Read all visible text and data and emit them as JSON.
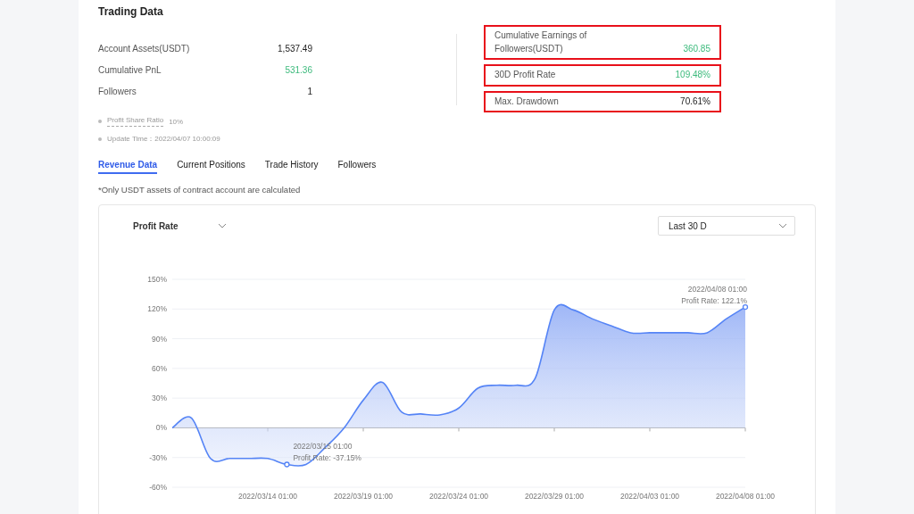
{
  "section_title": "Trading Data",
  "stats": [
    {
      "label": "Account Assets(USDT)",
      "value": "1,537.49",
      "positive": false
    },
    {
      "label": "Cumulative PnL",
      "value": "531.36",
      "positive": true
    },
    {
      "label": "Followers",
      "value": "1",
      "positive": false
    }
  ],
  "highlights": [
    {
      "label": "Cumulative Earnings of Followers(USDT)",
      "value": "360.85",
      "positive": true,
      "highlighted": true
    },
    {
      "label": "30D Profit Rate",
      "value": "109.48%",
      "positive": true,
      "highlighted": true
    },
    {
      "label": "Max. Drawdown",
      "value": "70.61%",
      "positive": false,
      "highlighted": true
    }
  ],
  "notes": [
    {
      "label": "Profit Share Ratio",
      "value": "10%",
      "kind": "tip"
    },
    {
      "label": "Update Time：2022/04/07 10:00:09",
      "kind": "plain"
    }
  ],
  "tabs": [
    {
      "label": "Revenue Data",
      "selected": true
    },
    {
      "label": "Current Positions",
      "selected": false
    },
    {
      "label": "Trade History",
      "selected": false
    },
    {
      "label": "Followers",
      "selected": false
    }
  ],
  "disclaimer": "*Only USDT assets of contract account are calculated",
  "chart_card": {
    "metric_select": "Profit Rate",
    "range_select": "Last 30 D",
    "chart_data": {
      "type": "area",
      "categories": [
        null,
        null,
        null,
        null,
        null,
        "2022/03/14 01:00",
        null,
        null,
        null,
        null,
        "2022/03/19 01:00",
        null,
        null,
        null,
        null,
        "2022/03/24 01:00",
        null,
        null,
        null,
        null,
        "2022/03/29 01:00",
        null,
        null,
        null,
        null,
        "2022/04/03 01:00",
        null,
        null,
        null,
        null,
        "2022/04/08 01:00"
      ],
      "series": [
        {
          "color": "#5584f6",
          "values": [
            0,
            10,
            -31,
            -31,
            -31,
            -31,
            -37,
            -37,
            -20,
            0,
            28,
            46,
            16,
            14,
            13,
            20,
            40,
            43,
            43,
            50,
            119,
            119,
            110,
            103,
            96,
            96,
            96,
            96,
            96,
            110,
            122
          ]
        }
      ],
      "ylim": [
        -60,
        150
      ],
      "grid": true,
      "yticks": [
        {
          "value": -60,
          "label": "-60%"
        },
        {
          "value": -30,
          "label": "-30%"
        },
        {
          "value": 0,
          "label": "0%"
        },
        {
          "value": 30,
          "label": "30%"
        },
        {
          "value": 60,
          "label": "60%"
        },
        {
          "value": 90,
          "label": "90%"
        },
        {
          "value": 120,
          "label": "120%"
        },
        {
          "value": 150,
          "label": "150%"
        }
      ],
      "annotations": [
        "2022/03/15 01:00\nProfit Rate: -37.15%",
        "2022/04/08 01:00\nProfit Rate: 122.1%"
      ]
    }
  }
}
